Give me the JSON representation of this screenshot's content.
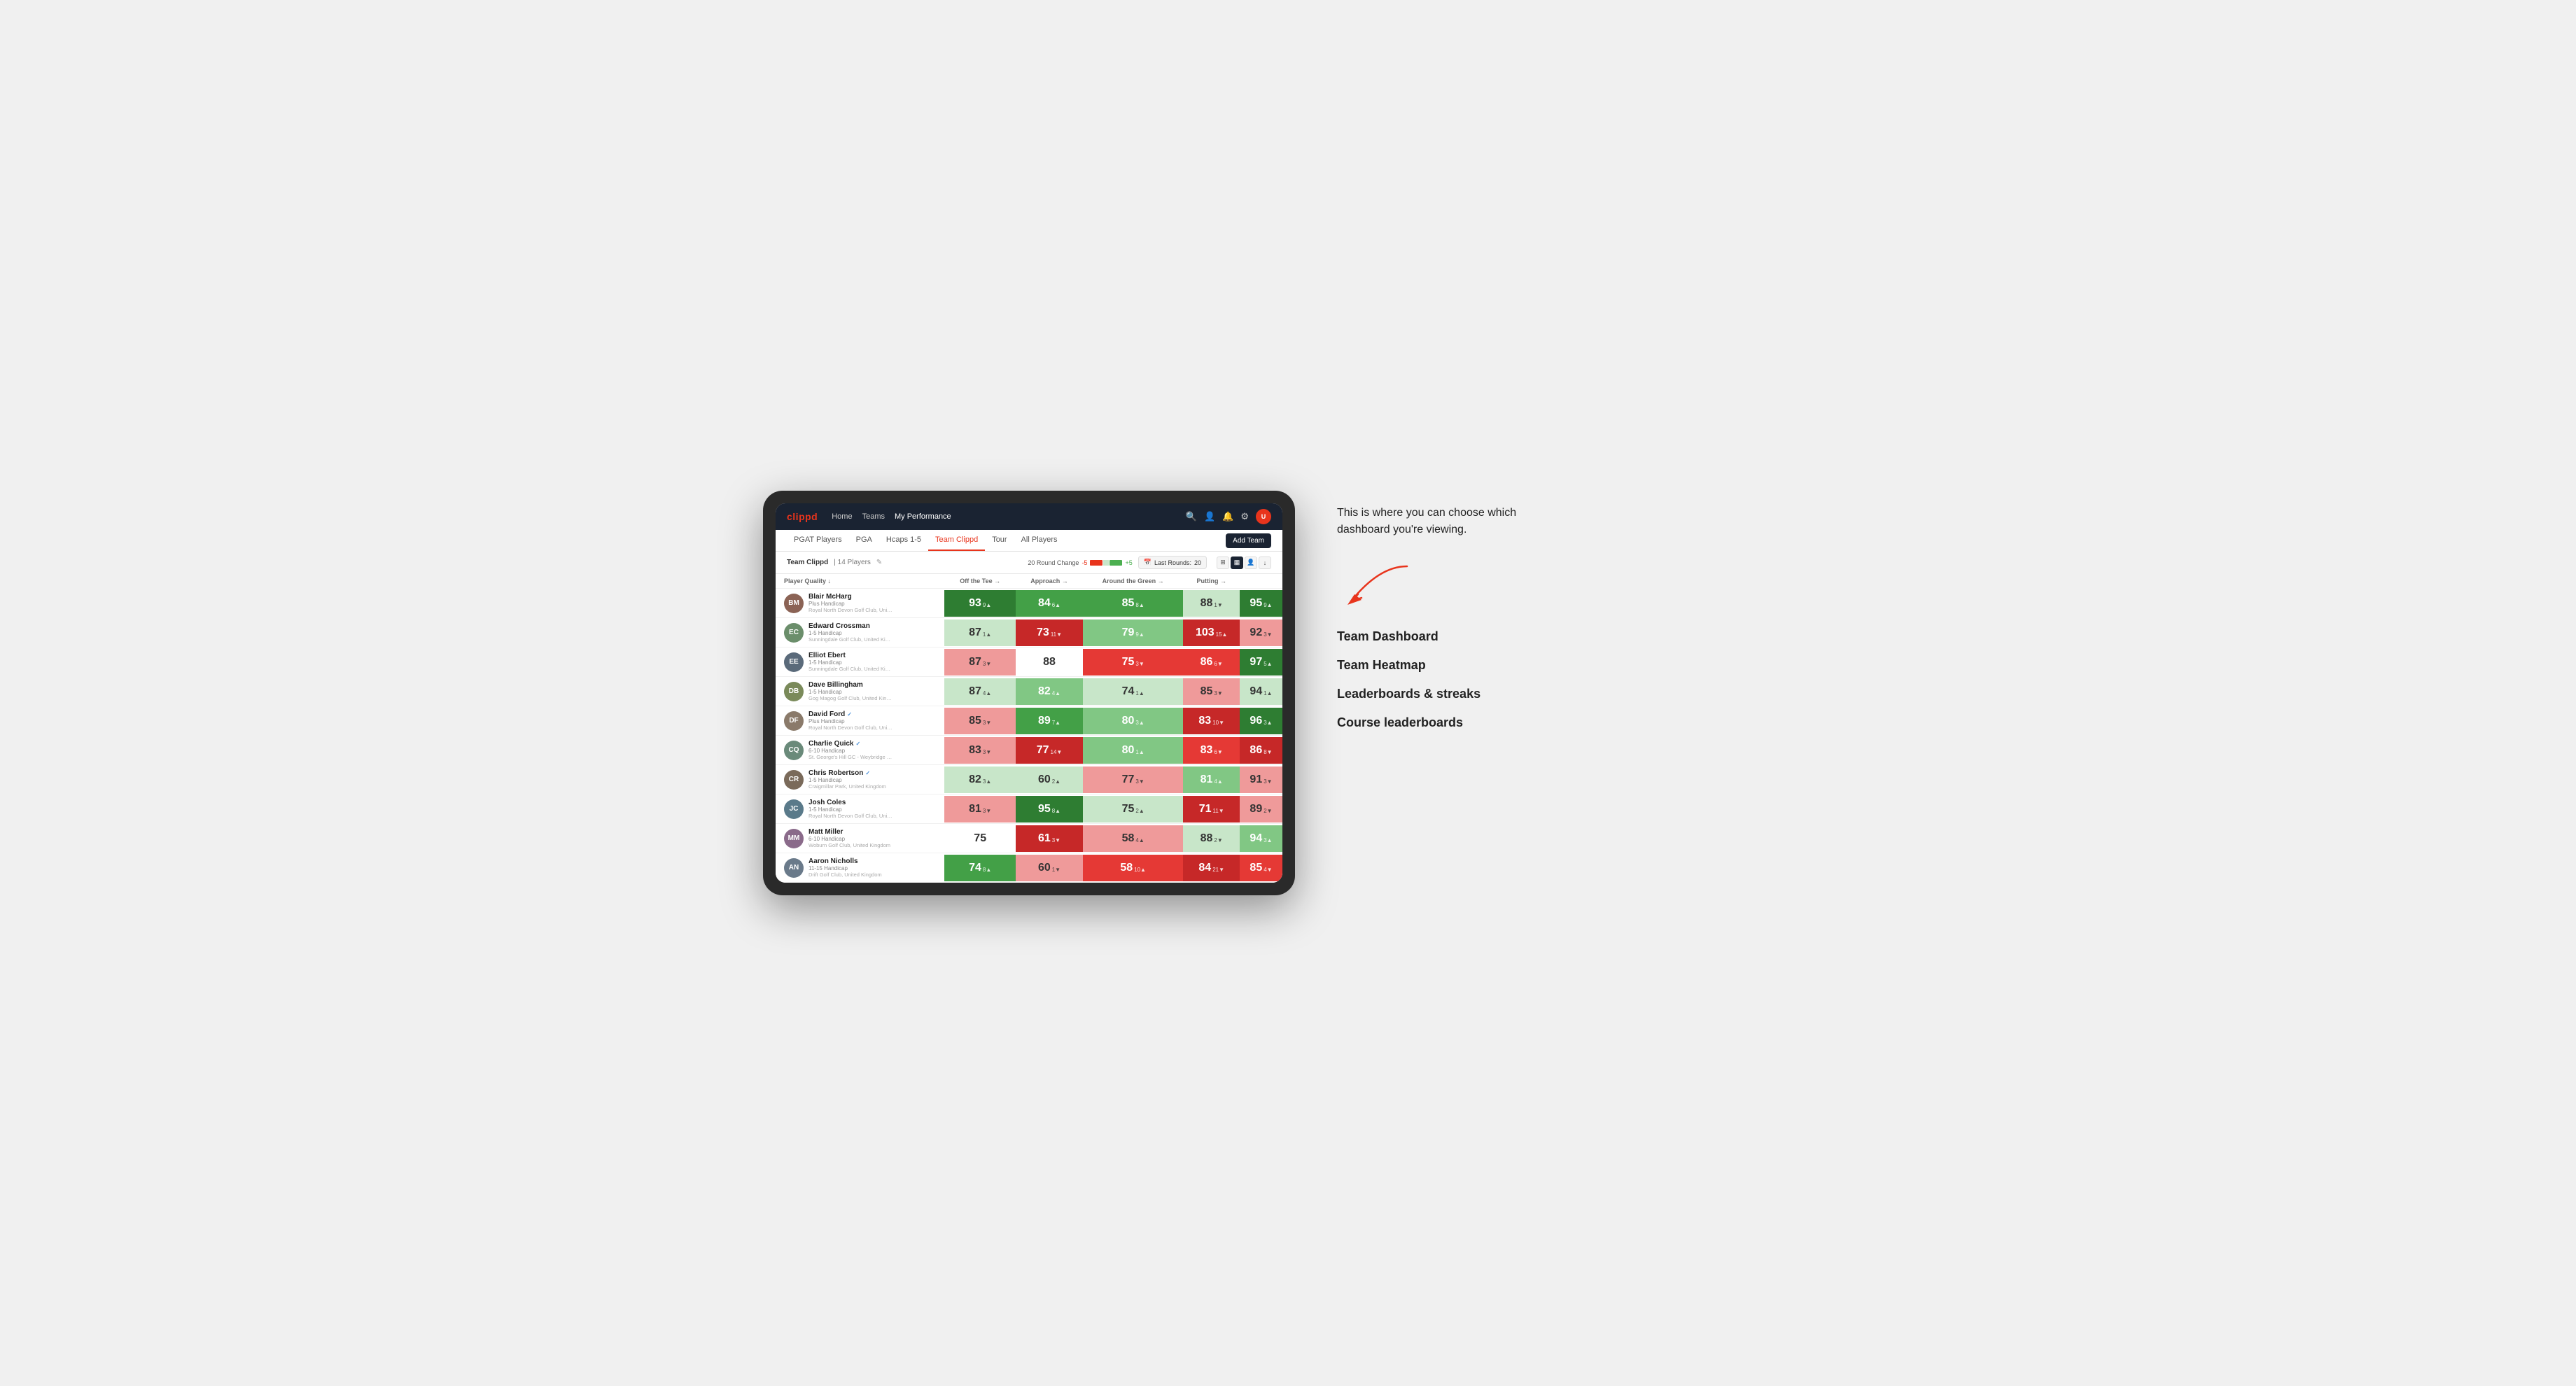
{
  "annotation": {
    "callout": "This is where you can choose which dashboard you're viewing.",
    "arrow_hint": "↗",
    "items": [
      "Team Dashboard",
      "Team Heatmap",
      "Leaderboards & streaks",
      "Course leaderboards"
    ]
  },
  "nav": {
    "logo": "clippd",
    "links": [
      "Home",
      "Teams",
      "My Performance"
    ],
    "active_link": "My Performance"
  },
  "sub_nav": {
    "links": [
      "PGAT Players",
      "PGA",
      "Hcaps 1-5",
      "Team Clippd",
      "Tour",
      "All Players"
    ],
    "active_link": "Team Clippd",
    "add_team_label": "Add Team"
  },
  "table_header": {
    "team_name": "Team Clippd",
    "player_count": "14 Players",
    "round_change_label": "20 Round Change",
    "scale_neg": "-5",
    "scale_pos": "+5",
    "last_rounds_label": "Last Rounds:",
    "last_rounds_value": "20"
  },
  "columns": [
    {
      "label": "Player Quality ↓",
      "key": "playerQuality"
    },
    {
      "label": "Off the Tee →",
      "key": "offTee"
    },
    {
      "label": "Approach →",
      "key": "approach"
    },
    {
      "label": "Around the Green →",
      "key": "aroundGreen"
    },
    {
      "label": "Putting →",
      "key": "putting"
    }
  ],
  "players": [
    {
      "name": "Blair McHarg",
      "handicap": "Plus Handicap",
      "club": "Royal North Devon Golf Club, United Kingdom",
      "initials": "BM",
      "color": "#8B6355",
      "scores": [
        {
          "value": "93",
          "change": "9",
          "dir": "up",
          "bg": "green-strong"
        },
        {
          "value": "84",
          "change": "6",
          "dir": "up",
          "bg": "green-medium"
        },
        {
          "value": "85",
          "change": "8",
          "dir": "up",
          "bg": "green-medium"
        },
        {
          "value": "88",
          "change": "1",
          "dir": "down",
          "bg": "green-pale"
        },
        {
          "value": "95",
          "change": "9",
          "dir": "up",
          "bg": "green-strong"
        }
      ]
    },
    {
      "name": "Edward Crossman",
      "handicap": "1-5 Handicap",
      "club": "Sunningdale Golf Club, United Kingdom",
      "initials": "EC",
      "color": "#6B8E6B",
      "scores": [
        {
          "value": "87",
          "change": "1",
          "dir": "up",
          "bg": "green-pale"
        },
        {
          "value": "73",
          "change": "11",
          "dir": "down",
          "bg": "red-strong"
        },
        {
          "value": "79",
          "change": "9",
          "dir": "up",
          "bg": "green-light"
        },
        {
          "value": "103",
          "change": "15",
          "dir": "up",
          "bg": "red-strong"
        },
        {
          "value": "92",
          "change": "3",
          "dir": "down",
          "bg": "red-light"
        }
      ]
    },
    {
      "name": "Elliot Ebert",
      "handicap": "1-5 Handicap",
      "club": "Sunningdale Golf Club, United Kingdom",
      "initials": "EE",
      "color": "#5a6a7a",
      "scores": [
        {
          "value": "87",
          "change": "3",
          "dir": "down",
          "bg": "red-light"
        },
        {
          "value": "88",
          "change": "",
          "dir": "",
          "bg": "white"
        },
        {
          "value": "75",
          "change": "3",
          "dir": "down",
          "bg": "red-medium"
        },
        {
          "value": "86",
          "change": "6",
          "dir": "down",
          "bg": "red-medium"
        },
        {
          "value": "97",
          "change": "5",
          "dir": "up",
          "bg": "green-strong"
        }
      ]
    },
    {
      "name": "Dave Billingham",
      "handicap": "1-5 Handicap",
      "club": "Gog Magog Golf Club, United Kingdom",
      "initials": "DB",
      "color": "#7a8a5a",
      "scores": [
        {
          "value": "87",
          "change": "4",
          "dir": "up",
          "bg": "green-pale"
        },
        {
          "value": "82",
          "change": "4",
          "dir": "up",
          "bg": "green-light"
        },
        {
          "value": "74",
          "change": "1",
          "dir": "up",
          "bg": "green-pale"
        },
        {
          "value": "85",
          "change": "3",
          "dir": "down",
          "bg": "red-light"
        },
        {
          "value": "94",
          "change": "1",
          "dir": "up",
          "bg": "green-pale"
        }
      ]
    },
    {
      "name": "David Ford",
      "handicap": "Plus Handicap",
      "club": "Royal North Devon Golf Club, United Kingdom",
      "verified": true,
      "initials": "DF",
      "color": "#8a7a6a",
      "scores": [
        {
          "value": "85",
          "change": "3",
          "dir": "down",
          "bg": "red-light"
        },
        {
          "value": "89",
          "change": "7",
          "dir": "up",
          "bg": "green-medium"
        },
        {
          "value": "80",
          "change": "3",
          "dir": "up",
          "bg": "green-light"
        },
        {
          "value": "83",
          "change": "10",
          "dir": "down",
          "bg": "red-strong"
        },
        {
          "value": "96",
          "change": "3",
          "dir": "up",
          "bg": "green-strong"
        }
      ]
    },
    {
      "name": "Charlie Quick",
      "handicap": "6-10 Handicap",
      "club": "St. George's Hill GC - Weybridge - Surrey, Uni...",
      "verified": true,
      "initials": "CQ",
      "color": "#6a8a7a",
      "scores": [
        {
          "value": "83",
          "change": "3",
          "dir": "down",
          "bg": "red-light"
        },
        {
          "value": "77",
          "change": "14",
          "dir": "down",
          "bg": "red-strong"
        },
        {
          "value": "80",
          "change": "1",
          "dir": "up",
          "bg": "green-light"
        },
        {
          "value": "83",
          "change": "6",
          "dir": "down",
          "bg": "red-medium"
        },
        {
          "value": "86",
          "change": "8",
          "dir": "down",
          "bg": "red-strong"
        }
      ]
    },
    {
      "name": "Chris Robertson",
      "handicap": "1-5 Handicap",
      "club": "Craigmillar Park, United Kingdom",
      "verified": true,
      "initials": "CR",
      "color": "#7a6a5a",
      "scores": [
        {
          "value": "82",
          "change": "3",
          "dir": "up",
          "bg": "green-pale"
        },
        {
          "value": "60",
          "change": "2",
          "dir": "up",
          "bg": "green-pale"
        },
        {
          "value": "77",
          "change": "3",
          "dir": "down",
          "bg": "red-light"
        },
        {
          "value": "81",
          "change": "4",
          "dir": "up",
          "bg": "green-light"
        },
        {
          "value": "91",
          "change": "3",
          "dir": "down",
          "bg": "red-light"
        }
      ]
    },
    {
      "name": "Josh Coles",
      "handicap": "1-5 Handicap",
      "club": "Royal North Devon Golf Club, United Kingdom",
      "initials": "JC",
      "color": "#5a7a8a",
      "scores": [
        {
          "value": "81",
          "change": "3",
          "dir": "down",
          "bg": "red-light"
        },
        {
          "value": "95",
          "change": "8",
          "dir": "up",
          "bg": "green-strong"
        },
        {
          "value": "75",
          "change": "2",
          "dir": "up",
          "bg": "green-pale"
        },
        {
          "value": "71",
          "change": "11",
          "dir": "down",
          "bg": "red-strong"
        },
        {
          "value": "89",
          "change": "2",
          "dir": "down",
          "bg": "red-light"
        }
      ]
    },
    {
      "name": "Matt Miller",
      "handicap": "6-10 Handicap",
      "club": "Woburn Golf Club, United Kingdom",
      "initials": "MM",
      "color": "#8a6a8a",
      "scores": [
        {
          "value": "75",
          "change": "",
          "dir": "",
          "bg": "white"
        },
        {
          "value": "61",
          "change": "3",
          "dir": "down",
          "bg": "red-strong"
        },
        {
          "value": "58",
          "change": "4",
          "dir": "up",
          "bg": "red-light"
        },
        {
          "value": "88",
          "change": "2",
          "dir": "down",
          "bg": "green-pale"
        },
        {
          "value": "94",
          "change": "3",
          "dir": "up",
          "bg": "green-light"
        }
      ]
    },
    {
      "name": "Aaron Nicholls",
      "handicap": "11-15 Handicap",
      "club": "Drift Golf Club, United Kingdom",
      "initials": "AN",
      "color": "#6a7a8a",
      "scores": [
        {
          "value": "74",
          "change": "8",
          "dir": "up",
          "bg": "green-medium"
        },
        {
          "value": "60",
          "change": "1",
          "dir": "down",
          "bg": "red-light"
        },
        {
          "value": "58",
          "change": "10",
          "dir": "up",
          "bg": "red-medium"
        },
        {
          "value": "84",
          "change": "21",
          "dir": "down",
          "bg": "red-strong"
        },
        {
          "value": "85",
          "change": "4",
          "dir": "down",
          "bg": "red-medium"
        }
      ]
    }
  ]
}
